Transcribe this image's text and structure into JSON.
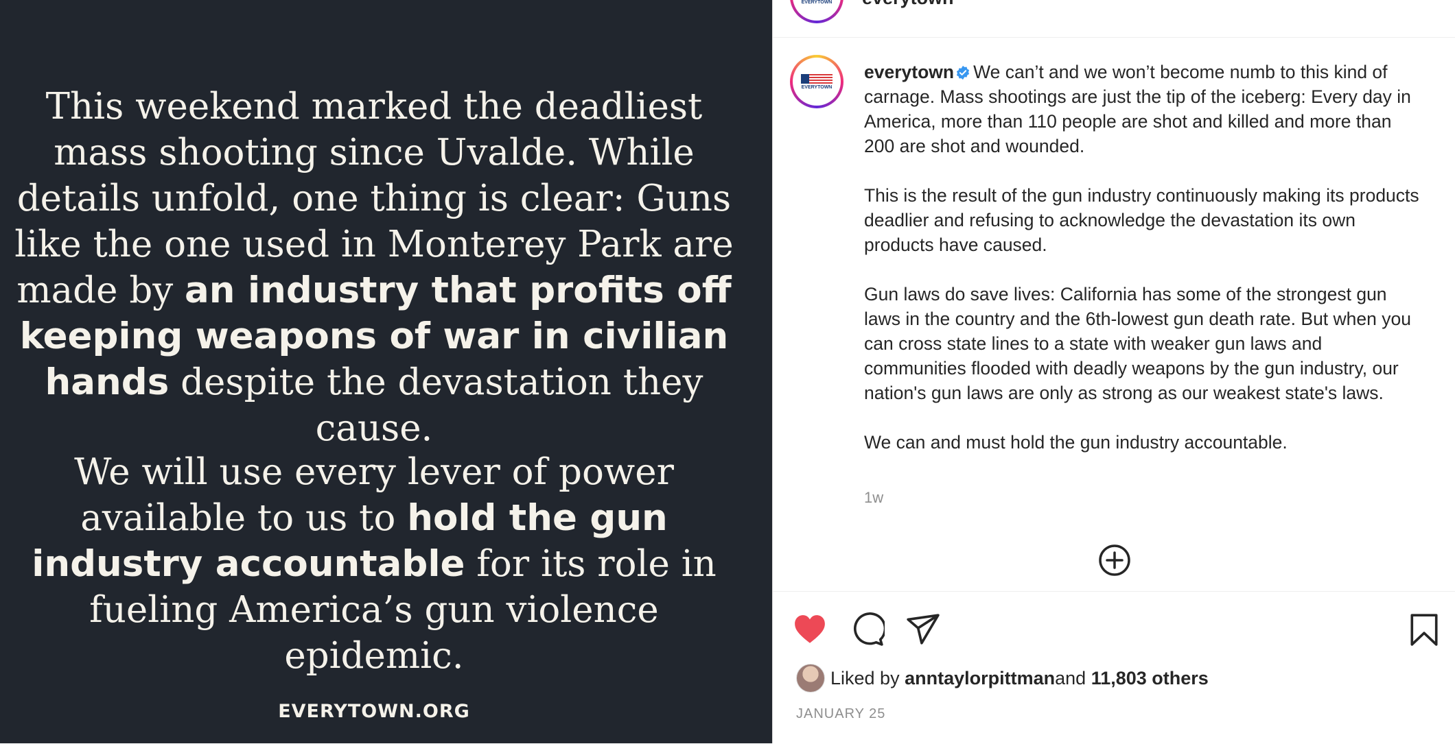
{
  "image": {
    "para1_plain": "This weekend marked the deadliest mass shooting since Uvalde. While details unfold, one thing is clear: Guns like the one used in Monterey Park are made by ",
    "para1_bold": "an industry that profits off keeping weapons of war in civilian hands",
    "para1_tail": " despite the devastation they cause.",
    "para2_lead": "We will use every lever of power available to us to ",
    "para2_bold": "hold the gun industry accountable",
    "para2_tail": " for its role in fueling America’s gun violence epidemic.",
    "footer": "EVERYTOWN.ORG"
  },
  "header": {
    "username": "everytown"
  },
  "avatar": {
    "logo_text": "EVERYTOWN"
  },
  "caption": {
    "username": "everytown",
    "p1": "We can’t and we won’t become numb to this kind of carnage. Mass shootings are just the tip of the iceberg: Every day in America, more than 110 people are shot and killed and more than 200 are shot and wounded.",
    "p2": "This is the result of the gun industry continuously making its products deadlier and refusing to acknowledge the devastation its own products have caused.",
    "p3": "Gun laws do save lives: California has some of the strongest gun laws in the country and the 6th-lowest gun death rate. But when you can cross state lines to a state with weaker gun laws and communities flooded with deadly weapons by the gun industry, our nation's gun laws are only as strong as our weakest state's laws.",
    "p4": "We can and must hold the gun industry accountable.",
    "time": "1w"
  },
  "likes": {
    "prefix": "Liked by ",
    "user": "anntaylorpittman",
    "middle": " and ",
    "others": "11,803 others"
  },
  "date": "JANUARY 25",
  "colors": {
    "image_bg": "#21262e",
    "image_text": "#f5f2ea",
    "like_red": "#ed4956",
    "verified_blue": "#3897f0"
  },
  "icons": [
    "heart-icon",
    "comment-icon",
    "share-icon",
    "bookmark-icon",
    "plus-circle-icon",
    "verified-badge-icon"
  ]
}
